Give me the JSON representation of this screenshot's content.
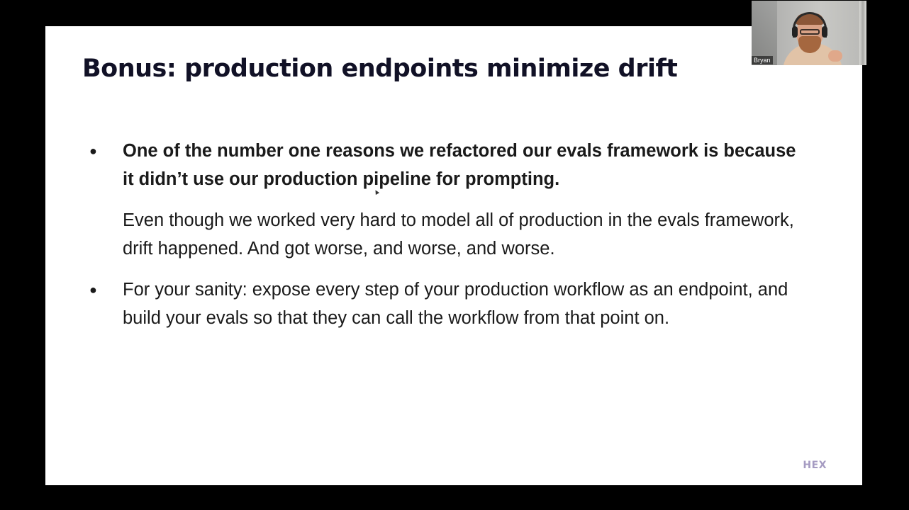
{
  "slide": {
    "title": "Bonus: production endpoints minimize drift",
    "bullets": [
      {
        "marker": "●",
        "text": "One of the number one reasons we refactored our evals framework is because it didn’t use our production pipeline for prompting.",
        "subtext": "Even though we worked very hard to model all of production in the evals framework, drift happened. And got worse, and worse, and worse."
      },
      {
        "marker": "●",
        "text": "For your sanity: expose every step of your production workflow as an endpoint, and build your evals so that they can call the workflow from that point on."
      }
    ],
    "brand": "HEX"
  },
  "video_tile": {
    "participant_name": "Bryan"
  },
  "colors": {
    "title": "#111126",
    "body_text": "#1a1a1a",
    "brand": "#a59bc2",
    "frame_background": "#000000",
    "slide_background": "#ffffff"
  },
  "icons": {
    "bullet": "filled-circle",
    "cursor": "mouse-pointer"
  }
}
